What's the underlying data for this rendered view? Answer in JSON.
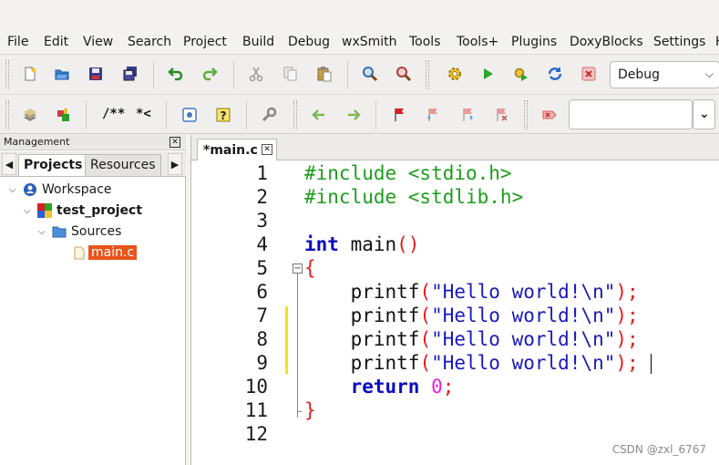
{
  "menu": [
    "File",
    "Edit",
    "View",
    "Search",
    "Project",
    "Build",
    "Debug",
    "wxSmith",
    "Tools",
    "Tools+",
    "Plugins",
    "DoxyBlocks",
    "Settings",
    "H"
  ],
  "toolbar": {
    "build_target": "Debug",
    "comment_label": "/**",
    "uncomment_label": "*<",
    "search_value": ""
  },
  "management": {
    "title": "Management",
    "tabs": [
      "Projects",
      "Resources"
    ],
    "tree": {
      "workspace": "Workspace",
      "project": "test_project",
      "folder": "Sources",
      "file": "main.c"
    }
  },
  "editor": {
    "tab_label": "*main.c",
    "lines": [
      {
        "n": "1",
        "tokens": [
          {
            "t": "#include <stdio.h>",
            "c": "pre"
          }
        ]
      },
      {
        "n": "2",
        "tokens": [
          {
            "t": "#include <stdlib.h>",
            "c": "pre"
          }
        ]
      },
      {
        "n": "3",
        "tokens": []
      },
      {
        "n": "4",
        "tokens": [
          {
            "t": "int",
            "c": "kw"
          },
          {
            "t": " main",
            "c": "id"
          },
          {
            "t": "()",
            "c": "paren"
          }
        ]
      },
      {
        "n": "5",
        "tokens": [
          {
            "t": "{",
            "c": "paren"
          }
        ]
      },
      {
        "n": "6",
        "tokens": [
          {
            "t": "    printf",
            "c": "id"
          },
          {
            "t": "(",
            "c": "paren"
          },
          {
            "t": "\"Hello world!\\n\"",
            "c": "str"
          },
          {
            "t": ");",
            "c": "paren"
          }
        ]
      },
      {
        "n": "7",
        "tokens": [
          {
            "t": "    printf",
            "c": "id"
          },
          {
            "t": "(",
            "c": "paren"
          },
          {
            "t": "\"Hello world!\\n\"",
            "c": "str"
          },
          {
            "t": ");",
            "c": "paren"
          }
        ]
      },
      {
        "n": "8",
        "tokens": [
          {
            "t": "    printf",
            "c": "id"
          },
          {
            "t": "(",
            "c": "paren"
          },
          {
            "t": "\"Hello world!\\n\"",
            "c": "str"
          },
          {
            "t": ");",
            "c": "paren"
          }
        ]
      },
      {
        "n": "9",
        "tokens": [
          {
            "t": "    printf",
            "c": "id"
          },
          {
            "t": "(",
            "c": "paren"
          },
          {
            "t": "\"Hello world!\\n\"",
            "c": "str"
          },
          {
            "t": ");",
            "c": "paren"
          }
        ]
      },
      {
        "n": "10",
        "tokens": [
          {
            "t": "    return",
            "c": "kw"
          },
          {
            "t": " 0",
            "c": "num"
          },
          {
            "t": ";",
            "c": "paren"
          }
        ]
      },
      {
        "n": "11",
        "tokens": [
          {
            "t": "}",
            "c": "paren"
          }
        ]
      },
      {
        "n": "12",
        "tokens": []
      }
    ]
  },
  "watermark": "CSDN @zxl_6767",
  "colors": {
    "selection": "#e8541b",
    "preprocessor": "#1c9e1c",
    "keyword": "#0b0bbf",
    "string": "#1a1ab8",
    "number": "#e81ee8",
    "operator": "#e41a1a",
    "changebar": "#f2e11a"
  }
}
